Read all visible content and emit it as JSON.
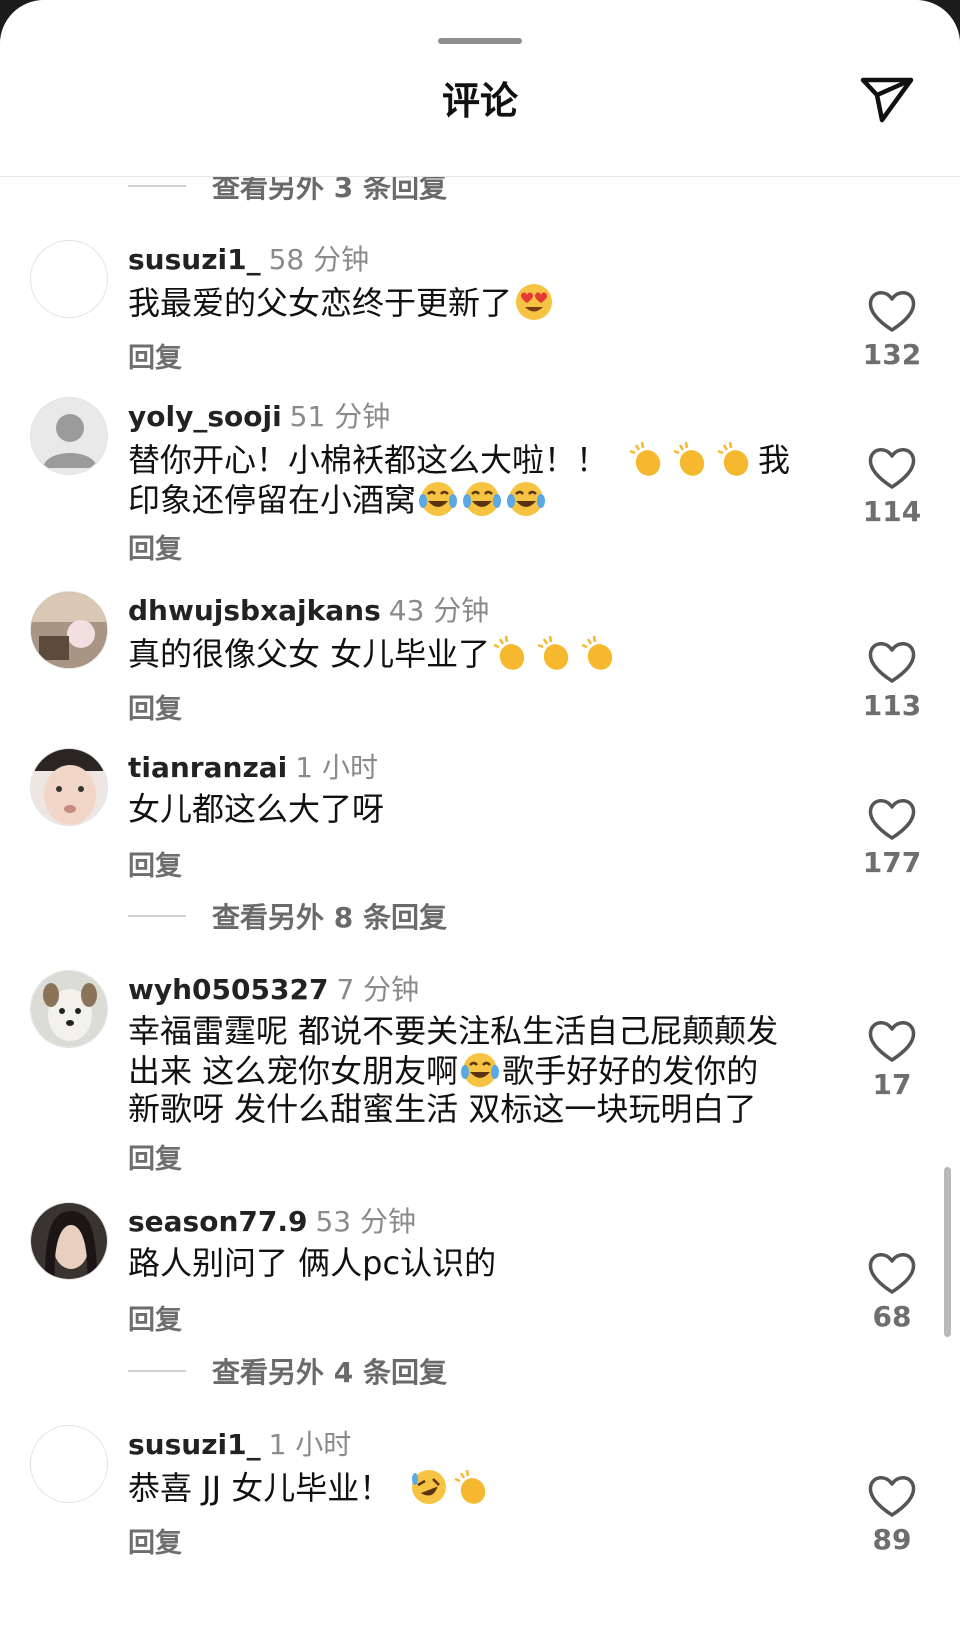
{
  "header": {
    "title": "评论",
    "send_icon": "send-icon"
  },
  "more_replies": [
    {
      "label": "查看另外 3 条回复"
    },
    {
      "label": "查看另外 8 条回复"
    },
    {
      "label": "查看另外 4 条回复"
    }
  ],
  "reply_label": "回复",
  "comments": [
    {
      "user": "susuzi1_",
      "time": "58 分钟",
      "text": "我最爱的父女恋终于更新了",
      "likes": "132",
      "avatar": "blank-avatar",
      "emoji": [
        "heart-eyes"
      ]
    },
    {
      "user": "yoly_sooji",
      "time": "51 分钟",
      "text1": "替你开心！小棉袄都这么大啦！！",
      "text2": "我",
      "text3": "印象还停留在小酒窝",
      "likes": "114",
      "avatar": "default-person-avatar",
      "emoji": [
        "clap",
        "clap",
        "clap",
        "laugh-cry",
        "laugh-cry",
        "laugh-cry"
      ]
    },
    {
      "user": "dhwujsbxajkans",
      "time": "43 分钟",
      "text": "真的很像父女 女儿毕业了",
      "likes": "113",
      "avatar": "photo-avatar",
      "emoji": [
        "clap",
        "clap",
        "clap"
      ]
    },
    {
      "user": "tianranzai",
      "time": "1 小时",
      "text": "女儿都这么大了呀",
      "likes": "177",
      "avatar": "face-photo-avatar"
    },
    {
      "user": "wyh0505327",
      "time": "7 分钟",
      "text1": "幸福雷霆呢 都说不要关注私生活自己屁颠颠发",
      "text2": "出来 这么宠你女朋友啊",
      "text3": "歌手好好的发你的",
      "text4": "新歌呀 发什么甜蜜生活 双标这一块玩明白了",
      "likes": "17",
      "avatar": "dog-photo-avatar",
      "emoji": [
        "laugh-cry"
      ]
    },
    {
      "user": "season77.9",
      "time": "53 分钟",
      "text": "路人别问了 俩人pc认识的",
      "likes": "68",
      "avatar": "portrait-photo-avatar"
    },
    {
      "user": "susuzi1_",
      "time": "1 小时",
      "text": "恭喜 JJ 女儿毕业！",
      "likes": "89",
      "avatar": "blank-avatar",
      "emoji": [
        "rofl",
        "clap"
      ]
    }
  ]
}
